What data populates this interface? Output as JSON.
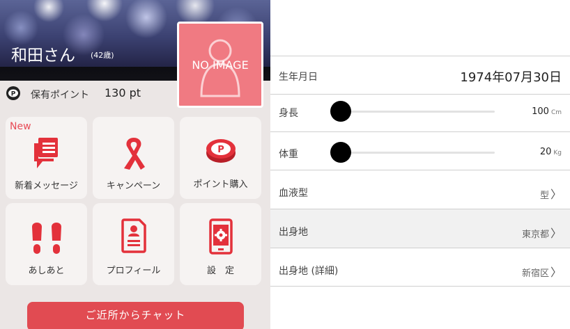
{
  "profile": {
    "name": "和田さん",
    "age": "(42歳)",
    "no_image_text": "NO IMAGE",
    "points_label": "保有ポイント",
    "points_value": "130 pt"
  },
  "menu": {
    "new_badge": "New",
    "items": [
      {
        "label": "新着メッセージ",
        "icon": "message-icon"
      },
      {
        "label": "キャンペーン",
        "icon": "ribbon-icon"
      },
      {
        "label": "ポイント購入",
        "icon": "point-coin-icon"
      },
      {
        "label": "あしあと",
        "icon": "footprints-icon"
      },
      {
        "label": "プロフィール",
        "icon": "profile-document-icon"
      },
      {
        "label": "設　定",
        "icon": "settings-phone-icon"
      }
    ],
    "chat_button": "ご近所からチャット"
  },
  "form": {
    "birthday": {
      "label": "生年月日",
      "value": "1974年07月30日"
    },
    "height": {
      "label": "身長",
      "value": "100",
      "unit": "Cm",
      "level": 0
    },
    "weight": {
      "label": "体重",
      "value": "20",
      "unit": "Kg",
      "level": 0
    },
    "blood": {
      "label": "血液型",
      "value": "型"
    },
    "birthplace": {
      "label": "出身地",
      "value": "東京都"
    },
    "birthplace_detail": {
      "label": "出身地 (詳細)",
      "value": "新宿区"
    }
  },
  "colors": {
    "accent": "#e14b52",
    "no_image_bg": "#f07a82",
    "icon_red": "#e3313b"
  }
}
